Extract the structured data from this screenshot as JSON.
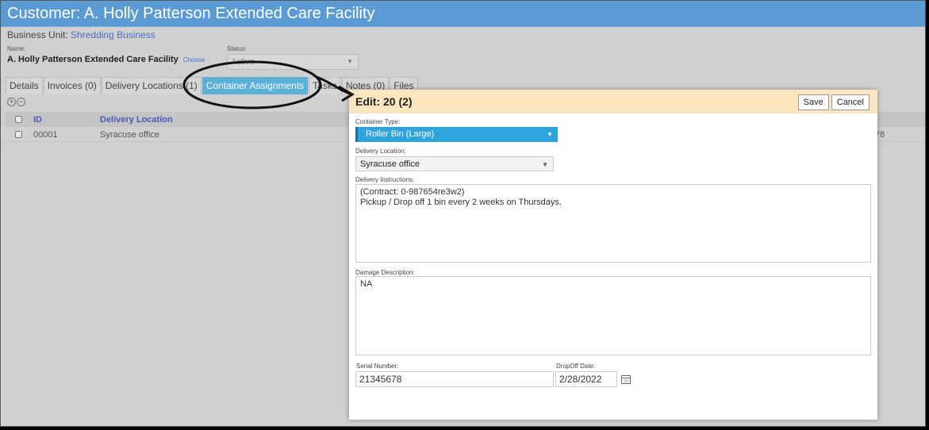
{
  "header": {
    "title": "Customer: A. Holly Patterson Extended Care Facility"
  },
  "business_unit": {
    "label": "Business Unit:",
    "value": "Shredding Business"
  },
  "name": {
    "label": "Name:",
    "value": "A. Holly Patterson Extended Care Facility",
    "choose_link": "Choose"
  },
  "status": {
    "label": "Status:",
    "value": "Active"
  },
  "tabs": [
    {
      "label": "Details"
    },
    {
      "label": "Invoices (0)"
    },
    {
      "label": "Delivery Locations (1)"
    },
    {
      "label": "Container Assignments"
    },
    {
      "label": "Tasks"
    },
    {
      "label": "Notes (0)"
    },
    {
      "label": "Files"
    }
  ],
  "grid": {
    "columns": {
      "id": "ID",
      "location": "Delivery Location"
    },
    "rows": [
      {
        "id": "00001",
        "location": "Syracuse office",
        "tail": "78"
      }
    ]
  },
  "modal": {
    "title": "Edit: 20 (2)",
    "save_label": "Save",
    "cancel_label": "Cancel",
    "container_type": {
      "label": "Container Type:",
      "value": "Roller Bin (Large)"
    },
    "delivery_location": {
      "label": "Delivery Location:",
      "value": "Syracuse office"
    },
    "delivery_instructions": {
      "label": "Delivery Instructions:",
      "value": "(Contract: 0-987654re3w2)\nPickup / Drop off 1 bin every 2 weeks on Thursdays."
    },
    "damage_description": {
      "label": "Damage Description:",
      "value": "NA"
    },
    "serial_number": {
      "label": "Serial Number:",
      "value": "21345678"
    },
    "dropoff_date": {
      "label": "DropOff Date:",
      "value": "2/28/2022"
    }
  },
  "colors": {
    "title_bar": "#5b9bd5",
    "active_tab": "#5bb0d8",
    "modal_header": "#fce6bf",
    "select_blue": "#2fa3dc"
  }
}
